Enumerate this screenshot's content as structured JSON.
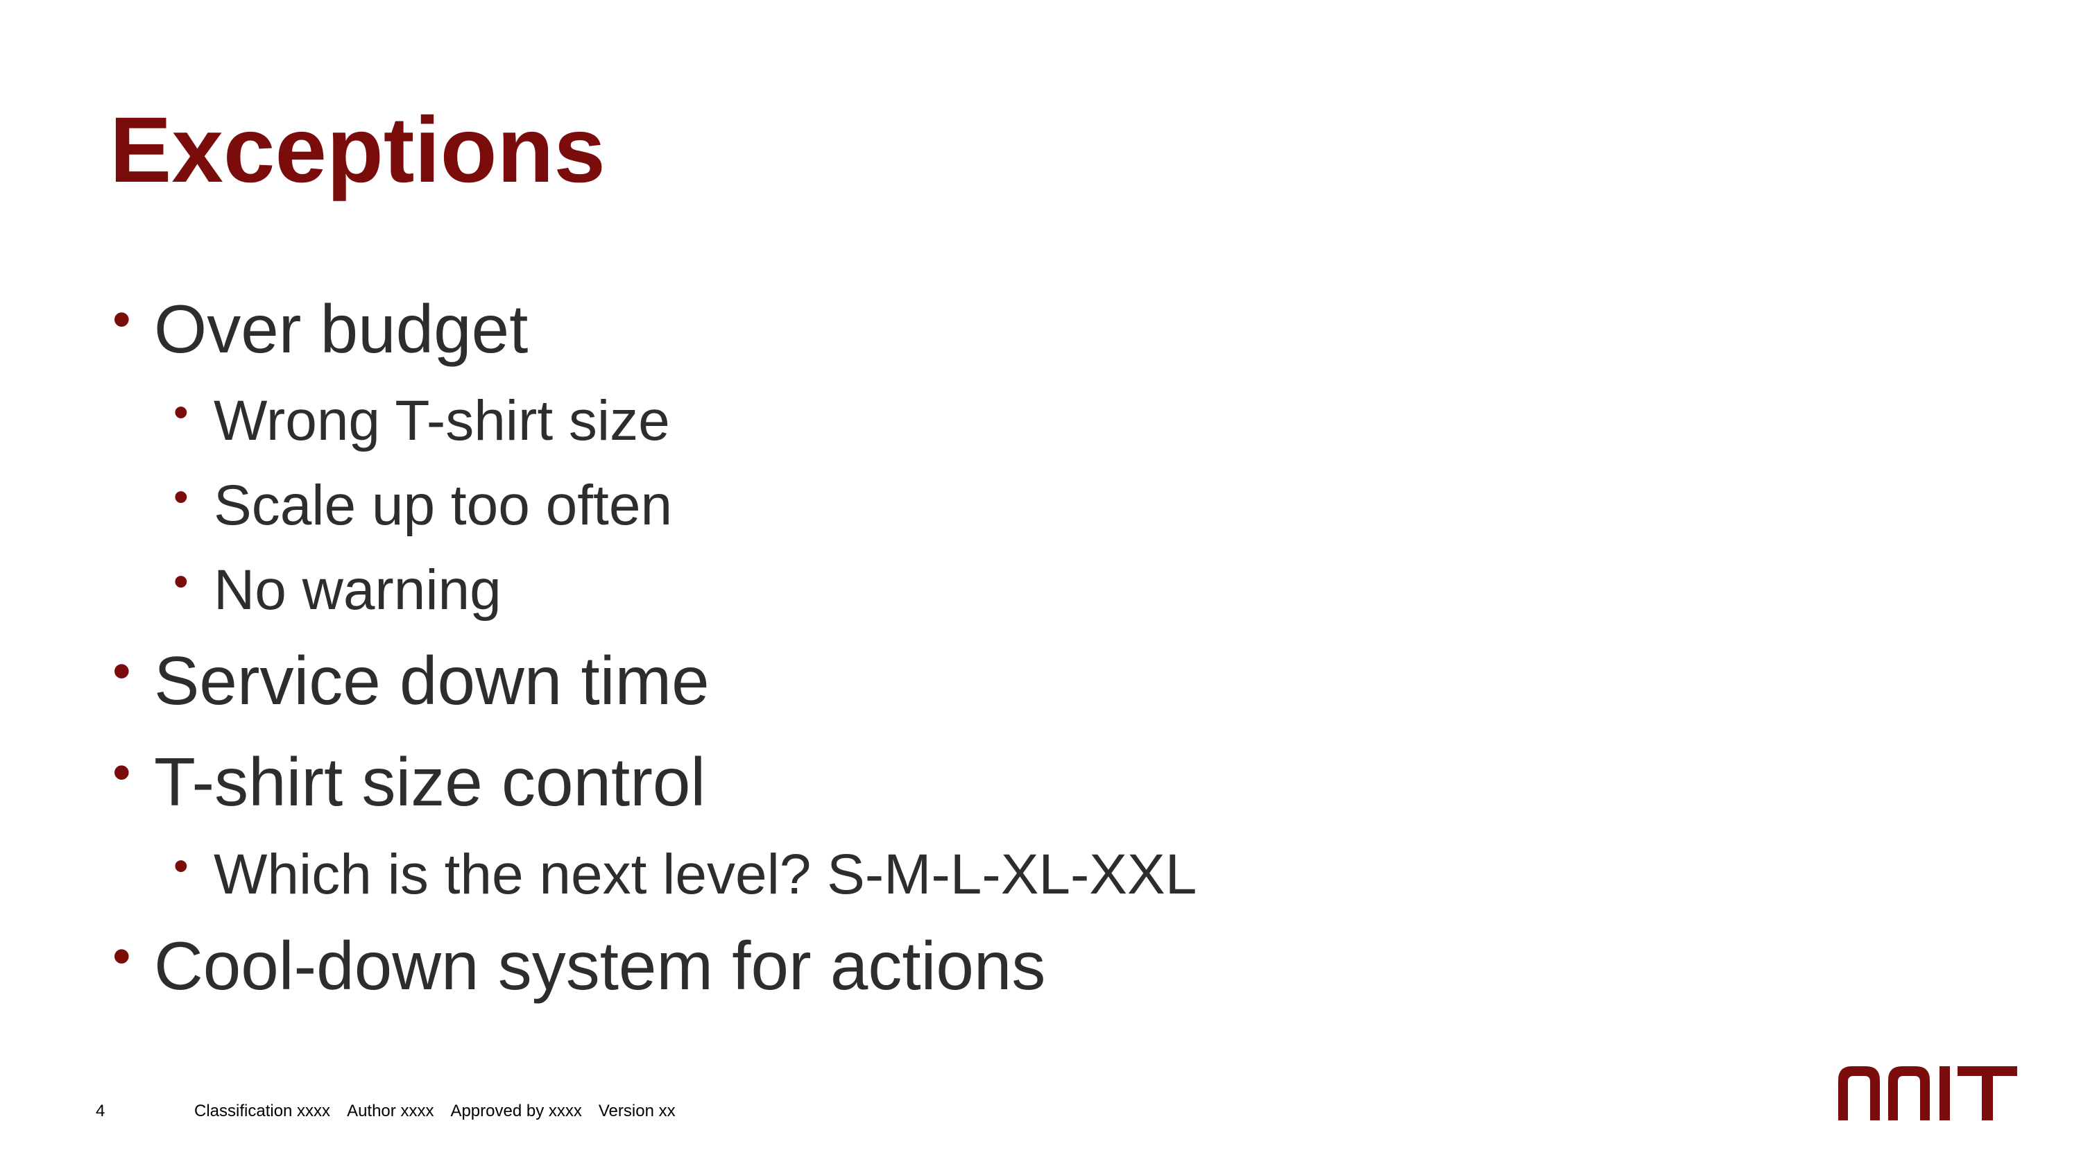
{
  "slide": {
    "title": "Exceptions",
    "bullets": [
      {
        "level": 1,
        "text": "Over budget"
      },
      {
        "level": 2,
        "text": "Wrong T-shirt size"
      },
      {
        "level": 2,
        "text": "Scale up too often"
      },
      {
        "level": 2,
        "text": "No warning"
      },
      {
        "level": 1,
        "text": "Service down time"
      },
      {
        "level": 1,
        "text": "T-shirt size control"
      },
      {
        "level": 2,
        "text": "Which is the next level?  S-M-L-XL-XXL"
      },
      {
        "level": 1,
        "text": "Cool-down system for actions"
      }
    ]
  },
  "footer": {
    "page_number": "4",
    "classification": "Classification xxxx",
    "author": "Author xxxx",
    "approved_by": "Approved by xxxx",
    "version": "Version xx"
  },
  "logo": {
    "text": "NNIT",
    "color": "#7b0c0c"
  },
  "colors": {
    "accent": "#7b0c0c",
    "body_text": "#2d2d2d"
  }
}
